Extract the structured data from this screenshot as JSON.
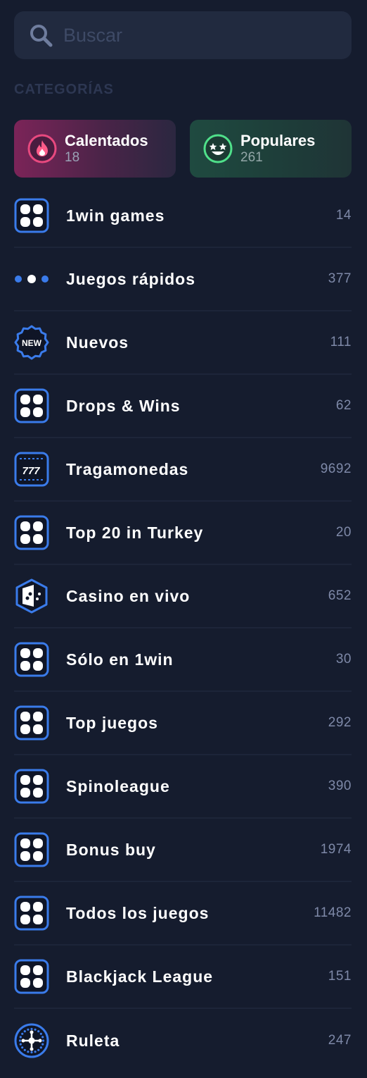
{
  "search": {
    "placeholder": "Buscar",
    "icon": "search-icon"
  },
  "section": {
    "title": "CATEGORÍAS"
  },
  "featured": [
    {
      "label": "Calentados",
      "count": "18",
      "icon": "flame-icon"
    },
    {
      "label": "Populares",
      "count": "261",
      "icon": "star-eyes-smiley-icon"
    }
  ],
  "categories": [
    {
      "label": "1win games",
      "count": "14",
      "icon": "grid-icon"
    },
    {
      "label": "Juegos rápidos",
      "count": "377",
      "icon": "dots-icon"
    },
    {
      "label": "Nuevos",
      "count": "111",
      "icon": "new-badge-icon",
      "icon_text": "NEW"
    },
    {
      "label": "Drops & Wins",
      "count": "62",
      "icon": "grid-icon"
    },
    {
      "label": "Tragamonedas",
      "count": "9692",
      "icon": "slot-icon",
      "icon_text": "777"
    },
    {
      "label": "Top 20 in Turkey",
      "count": "20",
      "icon": "grid-icon"
    },
    {
      "label": "Casino en vivo",
      "count": "652",
      "icon": "dice-icon"
    },
    {
      "label": "Sólo en 1win",
      "count": "30",
      "icon": "grid-icon"
    },
    {
      "label": "Top juegos",
      "count": "292",
      "icon": "grid-icon"
    },
    {
      "label": "Spinoleague",
      "count": "390",
      "icon": "grid-icon"
    },
    {
      "label": "Bonus buy",
      "count": "1974",
      "icon": "grid-icon"
    },
    {
      "label": "Todos los juegos",
      "count": "11482",
      "icon": "grid-icon"
    },
    {
      "label": "Blackjack League",
      "count": "151",
      "icon": "grid-icon"
    },
    {
      "label": "Ruleta",
      "count": "247",
      "icon": "roulette-icon"
    }
  ],
  "colors": {
    "background": "#151c2e",
    "accent_blue": "#3a7bea",
    "hot_tile": "#7b2458",
    "popular_tile": "#1f4a40",
    "count_text": "#7e89a8"
  }
}
